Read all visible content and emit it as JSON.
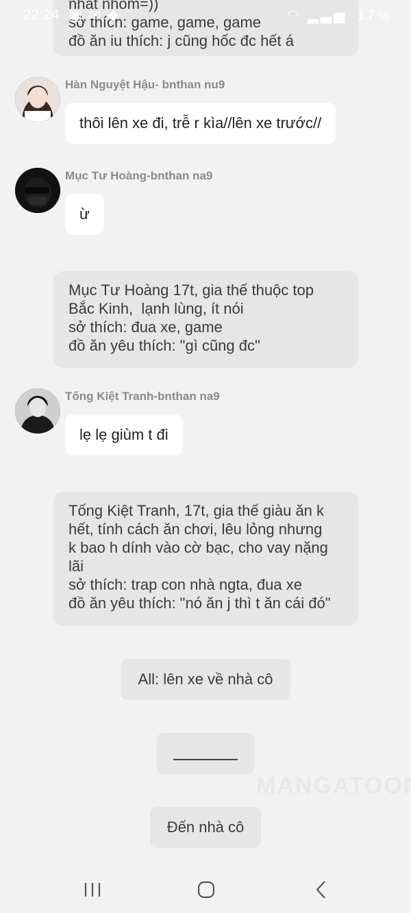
{
  "status_bar": {
    "time": "22:24",
    "battery": "17%"
  },
  "narration_top": {
    "lines": [
      "nhất nhóm=))",
      "sở thích: game, game, game",
      "đồ ăn iu thích: j cũng hốc đc hết á"
    ]
  },
  "messages": [
    {
      "sender": "Hàn Nguyệt Hậu- bnthan nu9",
      "text": "thôi lên xe đi, trễ r kìa//lên xe trước//"
    },
    {
      "sender": "Mục Tư Hoàng-bnthan na9",
      "text": "ừ"
    },
    {
      "sender": "Tống Kiệt Tranh-bnthan na9",
      "text": "lẹ lẹ giùm t đi"
    }
  ],
  "narration_muc": {
    "lines": [
      "Mục Tư Hoàng 17t, gia thế thuộc top",
      "Bắc Kinh,  lạnh lùng, ít nói",
      "sở thích: đua xe, game",
      "đồ ăn yêu thích: \"gì cũng đc\""
    ]
  },
  "narration_tong": {
    "lines": [
      "Tống Kiệt Tranh, 17t, gia thế giàu ăn k",
      "hết, tính cách ăn chơi, lêu lỏng nhưng",
      "k bao h dính vào cờ bạc, cho vay nặng",
      "lãi",
      "sở thích: trap con nhà ngta, đua xe",
      "đồ ăn yêu thích: \"nó ăn j thì t ăn cái đó\""
    ]
  },
  "center_messages": {
    "all": "All: lên xe về nhà cô",
    "arrive": "Đến nhà cô"
  },
  "watermark": "MANGATOON",
  "colors": {
    "background": "#f2f2f2",
    "bubble": "#ffffff",
    "narration": "#e6e6e6",
    "sender": "#8a8a8a"
  },
  "icons": {
    "nav_recents": "recents-icon",
    "nav_home": "home-icon",
    "nav_back": "back-icon"
  }
}
